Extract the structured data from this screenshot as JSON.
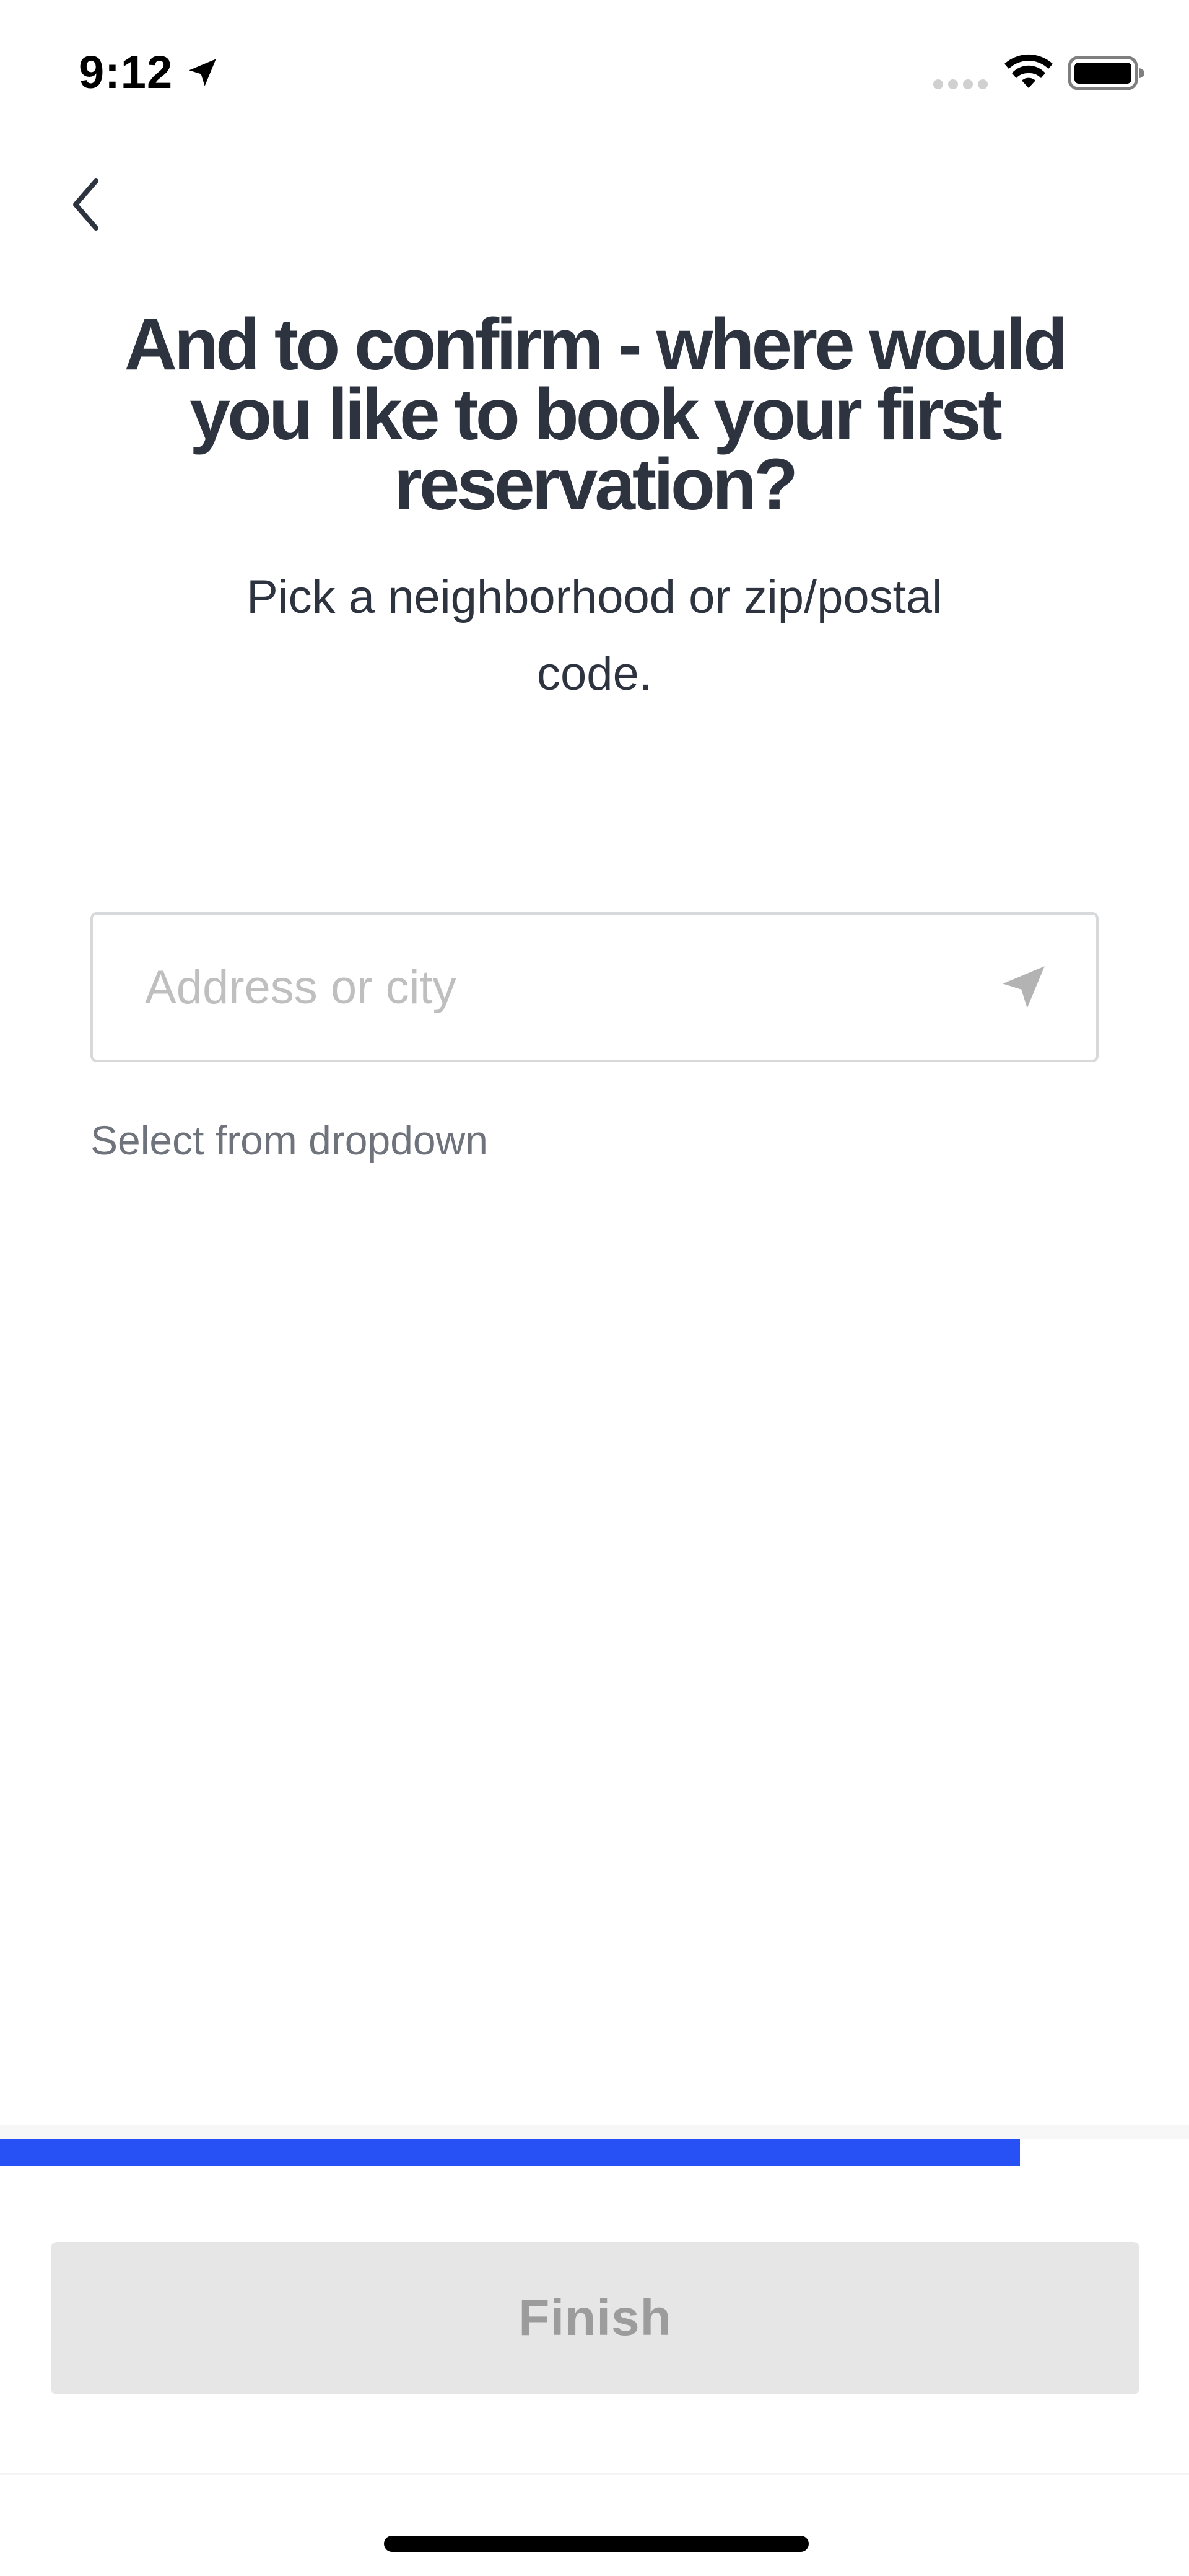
{
  "status_bar": {
    "time": "9:12"
  },
  "header": {
    "title": "And to confirm - where would you like to book your first reservation?",
    "subtitle": "Pick a neighborhood or zip/postal code."
  },
  "address": {
    "value": "",
    "placeholder": "Address or city",
    "helper": "Select from dropdown"
  },
  "progress": {
    "percent": 85.8
  },
  "footer": {
    "finish_label": "Finish"
  },
  "colors": {
    "accent": "#2750f5",
    "text_primary": "#2d333f",
    "button_disabled_bg": "#e6e6e6",
    "button_disabled_text": "#9c9c9c"
  },
  "icons": {
    "back": "chevron-left-icon",
    "location": "location-arrow-icon",
    "navigate": "navigate-icon",
    "wifi": "wifi-icon",
    "battery": "battery-icon",
    "signal": "signal-icon"
  }
}
